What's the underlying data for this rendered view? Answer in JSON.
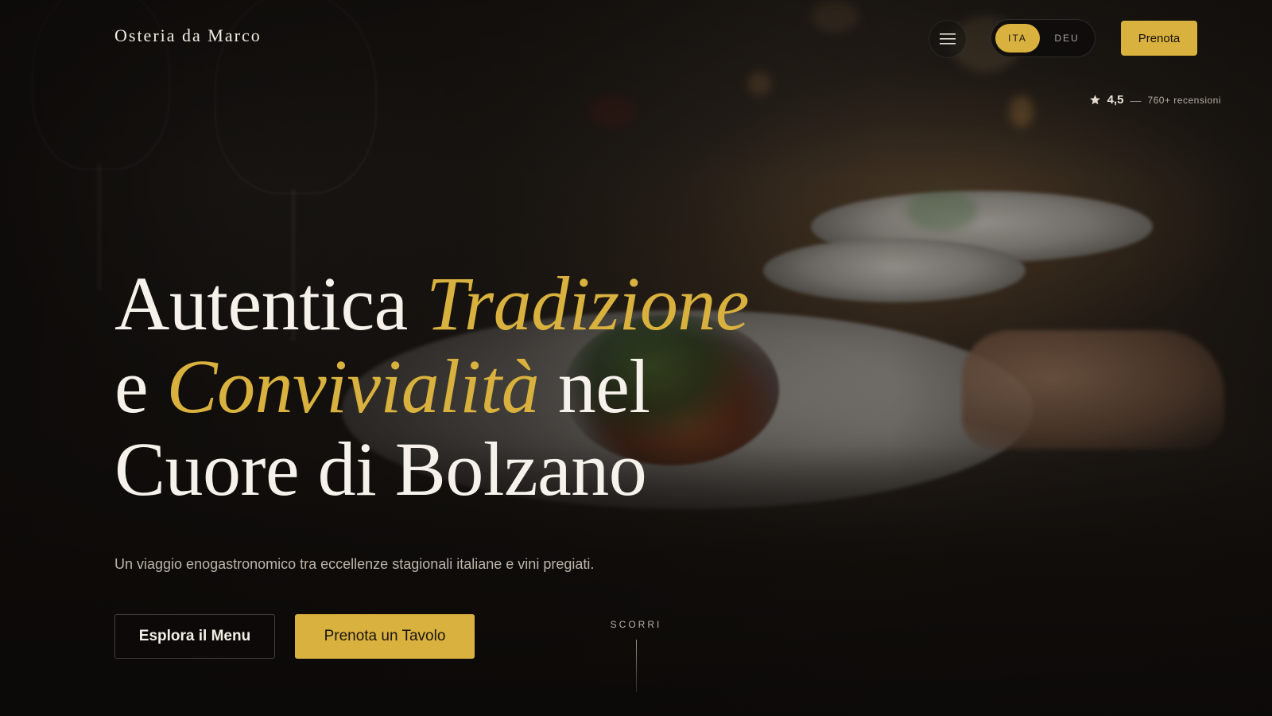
{
  "header": {
    "logo": "Osteria da Marco",
    "menu_icon": "hamburger-menu-icon",
    "languages": [
      {
        "label": "ITA",
        "active": true
      },
      {
        "label": "DEU",
        "active": false
      }
    ],
    "reserve_label": "Prenota"
  },
  "rating": {
    "icon": "star-icon",
    "score": "4,5",
    "separator": "—",
    "reviews": "760+ recensioni"
  },
  "hero": {
    "title_part1": "Autentica ",
    "title_gold1": "Tradizione",
    "title_part2": "e ",
    "title_gold2": "Convivialità",
    "title_part3": " nel",
    "title_part4": "Cuore di Bolzano",
    "subtitle": "Un viaggio enogastronomico tra eccellenze stagionali italiane e vini pregiati.",
    "primary_cta": "Esplora il Menu",
    "secondary_cta": "Prenota un Tavolo",
    "scroll_label": "SCORRI"
  },
  "colors": {
    "accent": "#d9b13e",
    "background": "#0f0d0b",
    "text": "#f6f1ea"
  }
}
